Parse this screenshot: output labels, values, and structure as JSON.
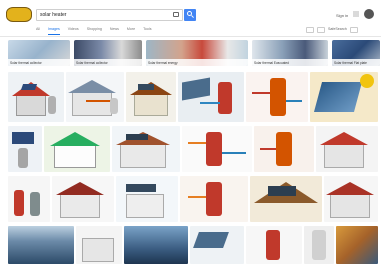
{
  "header": {
    "logo_text": "",
    "search_query": "solar heater",
    "signin_label": "Sign in"
  },
  "tabs": [
    {
      "label": "All",
      "active": false
    },
    {
      "label": "Images",
      "active": true
    },
    {
      "label": "Videos",
      "active": false
    },
    {
      "label": "Shopping",
      "active": false
    },
    {
      "label": "News",
      "active": false
    },
    {
      "label": "More",
      "active": false
    },
    {
      "label": "Tools",
      "active": false
    }
  ],
  "toolbar": {
    "safesearch_label": "SafeSearch"
  },
  "chips": [
    {
      "label": "Solar thermal collector"
    },
    {
      "label": "Solar thermal collector"
    },
    {
      "label": "Solar thermal energy"
    },
    {
      "label": "Solar thermal Evacuated"
    },
    {
      "label": "Solar thermal Flat plate"
    }
  ],
  "colors": {
    "accent": "#4285f4",
    "tab_active": "#1a73e8",
    "logo": "#e3b21c"
  }
}
